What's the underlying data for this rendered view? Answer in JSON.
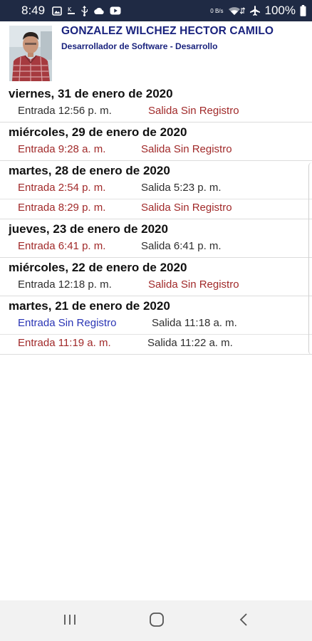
{
  "status_bar": {
    "time": "8:49",
    "network_speed_value": "0",
    "network_speed_unit": "B/s",
    "battery_percent": "100%",
    "icons_left": [
      "gallery-icon",
      "signal-k-icon",
      "usb-icon",
      "cloud-icon",
      "youtube-icon"
    ],
    "icons_right": [
      "wifi-data-icon",
      "airplane-icon",
      "battery-icon"
    ]
  },
  "user": {
    "name": "GONZALEZ WILCHEZ HECTOR CAMILO",
    "role": "Desarrollador de Software - Desarrollo"
  },
  "colors": {
    "status_bar_bg": "#1f2a44",
    "name_color": "#1a237e",
    "unrecorded_red": "#a12a2a",
    "unrecorded_blue": "#2a35b5",
    "normal_text": "#2e2e2e"
  },
  "days": [
    {
      "date": "viernes, 31 de enero de 2020",
      "records": [
        {
          "entry": "Entrada 12:56 p. m.",
          "entry_style": "normal",
          "exit": "Salida Sin Registro",
          "exit_style": "red"
        }
      ]
    },
    {
      "date": "miércoles, 29 de enero de 2020",
      "records": [
        {
          "entry": "Entrada 9:28 a. m.",
          "entry_style": "red",
          "exit": "Salida Sin Registro",
          "exit_style": "red"
        }
      ]
    },
    {
      "date": "martes, 28 de enero de 2020",
      "records": [
        {
          "entry": "Entrada 2:54 p. m.",
          "entry_style": "red",
          "exit": "Salida 5:23 p. m.",
          "exit_style": "normal"
        },
        {
          "entry": "Entrada 8:29 p. m.",
          "entry_style": "red",
          "exit": "Salida Sin Registro",
          "exit_style": "red"
        }
      ]
    },
    {
      "date": "jueves, 23 de enero de 2020",
      "records": [
        {
          "entry": "Entrada 6:41 p. m.",
          "entry_style": "red",
          "exit": "Salida 6:41 p. m.",
          "exit_style": "normal"
        }
      ]
    },
    {
      "date": "miércoles, 22 de enero de 2020",
      "records": [
        {
          "entry": "Entrada 12:18 p. m.",
          "entry_style": "normal",
          "exit": "Salida Sin Registro",
          "exit_style": "red"
        }
      ]
    },
    {
      "date": "martes, 21 de enero de 2020",
      "records": [
        {
          "entry": "Entrada Sin Registro",
          "entry_style": "blue",
          "exit": "Salida 11:18 a. m.",
          "exit_style": "normal"
        },
        {
          "entry": "Entrada 11:19 a. m.",
          "entry_style": "red",
          "exit": "Salida 11:22 a. m.",
          "exit_style": "normal"
        }
      ]
    }
  ],
  "nav_bar": {
    "buttons": [
      "recent-apps-icon",
      "home-icon",
      "back-icon"
    ]
  }
}
